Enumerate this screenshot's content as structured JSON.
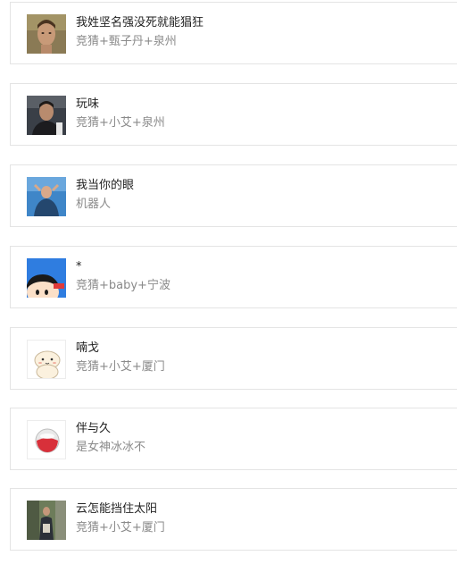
{
  "contacts": [
    {
      "name": "我姓坚名强没死就能猖狂",
      "subtitle": "竞猜+甄子丹+泉州",
      "avatar_icon": "portrait-photo-icon"
    },
    {
      "name": "玩味",
      "subtitle": "竞猜+小艾+泉州",
      "avatar_icon": "portrait-photo-icon"
    },
    {
      "name": "我当你的眼",
      "subtitle": "机器人",
      "avatar_icon": "person-sky-photo-icon"
    },
    {
      "name": "*",
      "subtitle": "竞猜+baby+宁波",
      "avatar_icon": "cartoon-girl-icon"
    },
    {
      "name": "喃戈",
      "subtitle": "竞猜+小艾+厦门",
      "avatar_icon": "cartoon-bun-icon"
    },
    {
      "name": "伴与久",
      "subtitle": "是女神冰冰不",
      "avatar_icon": "red-glass-button-icon"
    },
    {
      "name": "云怎能挡住太阳",
      "subtitle": "竞猜+小艾+厦门",
      "avatar_icon": "street-photo-icon"
    }
  ],
  "colors": {
    "name_text": "#222222",
    "subtitle_text": "#8a8a8a",
    "card_border": "#e4e4e4"
  }
}
